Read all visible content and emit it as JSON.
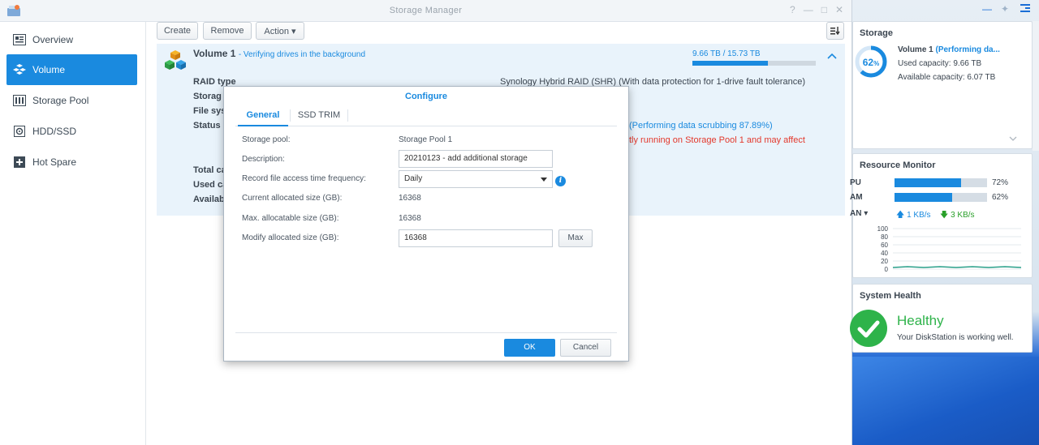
{
  "window": {
    "title": "Storage Manager",
    "controls": [
      "?",
      "—",
      "□",
      "✕"
    ]
  },
  "sidebar": {
    "items": [
      {
        "label": "Overview",
        "icon": "overview-icon"
      },
      {
        "label": "Volume",
        "icon": "volume-icon",
        "active": true
      },
      {
        "label": "Storage Pool",
        "icon": "storage-pool-icon"
      },
      {
        "label": "HDD/SSD",
        "icon": "hdd-icon"
      },
      {
        "label": "Hot Spare",
        "icon": "hot-spare-icon"
      }
    ]
  },
  "toolbar": {
    "create_label": "Create",
    "remove_label": "Remove",
    "action_label": "Action ▾"
  },
  "volume": {
    "name": "Volume 1",
    "status": "- Verifying drives in the background",
    "usage": "9.66 TB / 15.73 TB",
    "usage_fraction": 0.614,
    "rows": {
      "raid_type_label": "RAID type",
      "raid_type_value": "Synology Hybrid RAID (SHR) (With data protection for 1-drive fault tolerance)",
      "storage_label": "Storag",
      "filesys_label": "File sys",
      "status_label": "Status",
      "status_value": "(Performing data scrubbing 87.89%)",
      "warning_value": "tly running on Storage Pool 1 and may affect",
      "total_label": "Total ca",
      "used_label": "Used ca",
      "avail_label": "Availab"
    }
  },
  "dialog": {
    "title": "Configure",
    "tabs": [
      "General",
      "SSD TRIM"
    ],
    "storage_pool_label": "Storage pool:",
    "storage_pool_value": "Storage Pool 1",
    "description_label": "Description:",
    "description_value": "20210123 - add additional storage",
    "record_label": "Record file access time frequency:",
    "record_value": "Daily",
    "current_label": "Current allocated size (GB):",
    "current_value": "16368",
    "max_label": "Max. allocatable size (GB):",
    "max_value": "16368",
    "modify_label": "Modify allocated size (GB):",
    "modify_value": "16368",
    "max_button": "Max",
    "ok_button": "OK",
    "cancel_button": "Cancel"
  },
  "storage_widget": {
    "title": "Storage",
    "percent": "62",
    "percent_suffix": "%",
    "percent_value": 62,
    "volume_label": "Volume 1",
    "volume_status": "(Performing da...",
    "used": "Used capacity: 9.66 TB",
    "available": "Available capacity: 6.07 TB"
  },
  "resource_monitor": {
    "title": "Resource Monitor",
    "cpu_label": "PU",
    "cpu_pct": "72%",
    "cpu_value": 72,
    "ram_label": "AM",
    "ram_pct": "62%",
    "ram_value": 62,
    "lan_label": "AN ▾",
    "upload": "1 KB/s",
    "download": "3 KB/s",
    "y_ticks": [
      "100",
      "80",
      "60",
      "40",
      "20",
      "0"
    ]
  },
  "system_health": {
    "title": "System Health",
    "status": "Healthy",
    "message": "Your DiskStation is working well."
  },
  "colors": {
    "accent": "#1a8adf",
    "healthy": "#2eb34a",
    "warning": "#e3382c"
  }
}
